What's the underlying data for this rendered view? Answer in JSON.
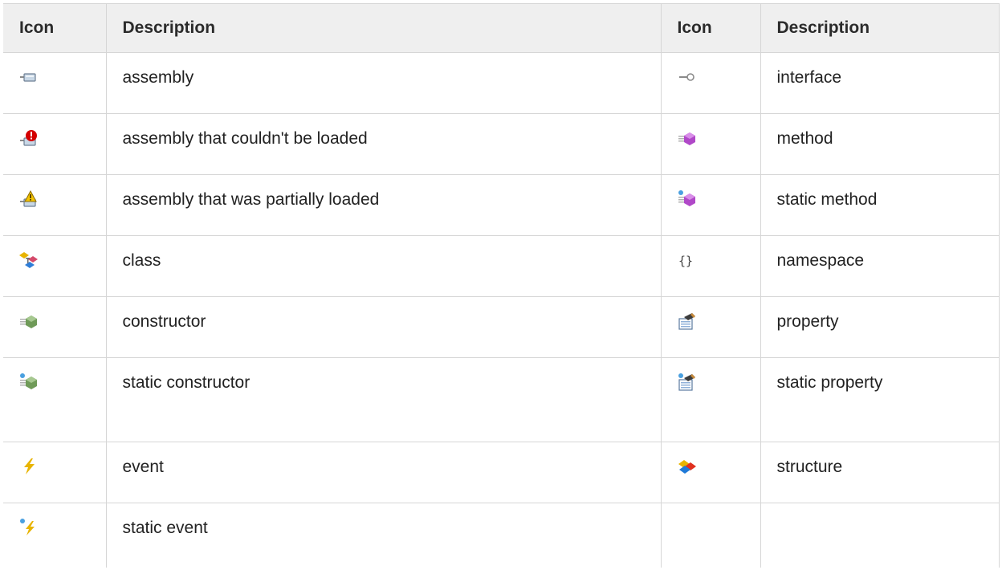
{
  "headers": {
    "icon1": "Icon",
    "desc1": "Description",
    "icon2": "Icon",
    "desc2": "Description"
  },
  "rows": [
    {
      "left": {
        "icon": "assembly-icon",
        "label": "assembly"
      },
      "right": {
        "icon": "interface-icon",
        "label": "interface"
      }
    },
    {
      "left": {
        "icon": "assembly-error-icon",
        "label": "assembly that couldn't be loaded"
      },
      "right": {
        "icon": "method-icon",
        "label": "method"
      }
    },
    {
      "left": {
        "icon": "assembly-warning-icon",
        "label": "assembly that was partially loaded"
      },
      "right": {
        "icon": "static-method-icon",
        "label": "static method"
      }
    },
    {
      "left": {
        "icon": "class-icon",
        "label": "class"
      },
      "right": {
        "icon": "namespace-icon",
        "label": "namespace"
      }
    },
    {
      "left": {
        "icon": "constructor-icon",
        "label": "constructor"
      },
      "right": {
        "icon": "property-icon",
        "label": "property"
      }
    },
    {
      "left": {
        "icon": "static-constructor-icon",
        "label": "static constructor"
      },
      "right": {
        "icon": "static-property-icon",
        "label": "static property"
      }
    },
    {
      "left": {
        "icon": "event-icon",
        "label": "event"
      },
      "right": {
        "icon": "structure-icon",
        "label": "structure"
      }
    },
    {
      "left": {
        "icon": "static-event-icon",
        "label": "static event"
      },
      "right": {
        "icon": "",
        "label": ""
      }
    }
  ],
  "colors": {
    "header_bg": "#efefef",
    "border": "#d6d6d6",
    "error_red": "#d40000",
    "warning_yellow": "#f5c400",
    "method_purple": "#b048c8",
    "constructor_green": "#6f9a58",
    "event_yellow": "#e8b400",
    "structure_red": "#e0301e",
    "structure_blue": "#1f7ad8"
  }
}
